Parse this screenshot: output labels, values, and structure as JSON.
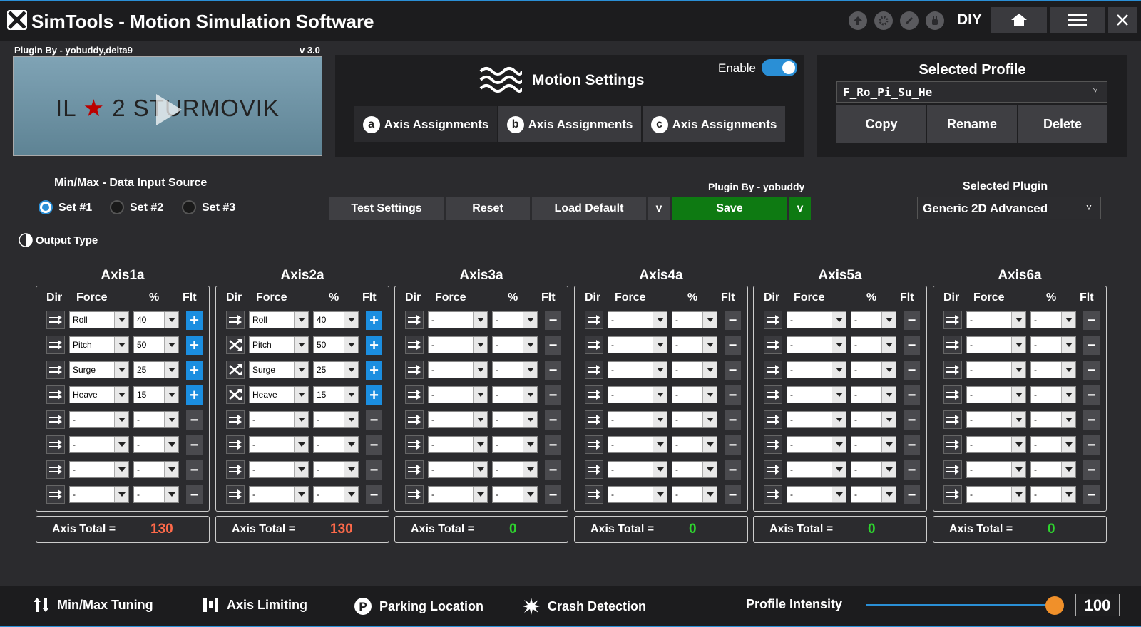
{
  "app": {
    "title": "SimTools - Motion Simulation Software",
    "mode": "DIY"
  },
  "plugin_info": {
    "by": "Plugin By - yobuddy,delta9",
    "version": "v 3.0"
  },
  "game_banner": {
    "title": "IL",
    "star": "★",
    "title_rest": "2 STURMOVIK"
  },
  "motion": {
    "title": "Motion Settings",
    "enable_label": "Enable",
    "enabled": true,
    "tabs": [
      {
        "letter": "a",
        "label": "Axis Assignments"
      },
      {
        "letter": "b",
        "label": "Axis Assignments"
      },
      {
        "letter": "c",
        "label": "Axis Assignments"
      }
    ]
  },
  "profile": {
    "title": "Selected Profile",
    "value": "F_Ro_Pi_Su_He",
    "copy": "Copy",
    "rename": "Rename",
    "delete": "Delete"
  },
  "data_input": {
    "title": "Min/Max - Data Input Source",
    "options": [
      "Set #1",
      "Set #2",
      "Set #3"
    ],
    "selected": "Set #1"
  },
  "actions": {
    "plugin_by": "Plugin By - yobuddy",
    "test": "Test Settings",
    "reset": "Reset",
    "load_default": "Load Default",
    "save": "Save",
    "chevron": "v"
  },
  "plugin": {
    "title": "Selected Plugin",
    "value": "Generic 2D Advanced",
    "chevron": "v"
  },
  "output_type": "Output Type",
  "axis_headers": {
    "dir": "Dir",
    "force": "Force",
    "pct": "%",
    "flt": "Flt"
  },
  "total_label": "Axis Total =",
  "axes": [
    {
      "name": "Axis1a",
      "total": "130",
      "total_color": "#ff6a4a",
      "rows": [
        [
          "Roll",
          "40",
          "plus",
          "normal"
        ],
        [
          "Pitch",
          "50",
          "plus",
          "normal"
        ],
        [
          "Surge",
          "25",
          "plus",
          "normal"
        ],
        [
          "Heave",
          "15",
          "plus",
          "normal"
        ],
        [
          "-",
          "-",
          "minus",
          "normal"
        ],
        [
          "-",
          "-",
          "minus",
          "normal"
        ],
        [
          "-",
          "-",
          "minus",
          "normal"
        ],
        [
          "-",
          "-",
          "minus",
          "normal"
        ]
      ]
    },
    {
      "name": "Axis2a",
      "total": "130",
      "total_color": "#ff6a4a",
      "rows": [
        [
          "Roll",
          "40",
          "plus",
          "normal"
        ],
        [
          "Pitch",
          "50",
          "plus",
          "reverse"
        ],
        [
          "Surge",
          "25",
          "plus",
          "reverse"
        ],
        [
          "Heave",
          "15",
          "plus",
          "reverse"
        ],
        [
          "-",
          "-",
          "minus",
          "normal"
        ],
        [
          "-",
          "-",
          "minus",
          "normal"
        ],
        [
          "-",
          "-",
          "minus",
          "normal"
        ],
        [
          "-",
          "-",
          "minus",
          "normal"
        ]
      ]
    },
    {
      "name": "Axis3a",
      "total": "0",
      "total_color": "#2ed42e",
      "rows": [
        [
          "-",
          "-",
          "minus",
          "normal"
        ],
        [
          "-",
          "-",
          "minus",
          "normal"
        ],
        [
          "-",
          "-",
          "minus",
          "normal"
        ],
        [
          "-",
          "-",
          "minus",
          "normal"
        ],
        [
          "-",
          "-",
          "minus",
          "normal"
        ],
        [
          "-",
          "-",
          "minus",
          "normal"
        ],
        [
          "-",
          "-",
          "minus",
          "normal"
        ],
        [
          "-",
          "-",
          "minus",
          "normal"
        ]
      ]
    },
    {
      "name": "Axis4a",
      "total": "0",
      "total_color": "#2ed42e",
      "rows": [
        [
          "-",
          "-",
          "minus",
          "normal"
        ],
        [
          "-",
          "-",
          "minus",
          "normal"
        ],
        [
          "-",
          "-",
          "minus",
          "normal"
        ],
        [
          "-",
          "-",
          "minus",
          "normal"
        ],
        [
          "-",
          "-",
          "minus",
          "normal"
        ],
        [
          "-",
          "-",
          "minus",
          "normal"
        ],
        [
          "-",
          "-",
          "minus",
          "normal"
        ],
        [
          "-",
          "-",
          "minus",
          "normal"
        ]
      ]
    },
    {
      "name": "Axis5a",
      "total": "0",
      "total_color": "#2ed42e",
      "rows": [
        [
          "-",
          "-",
          "minus",
          "normal"
        ],
        [
          "-",
          "-",
          "minus",
          "normal"
        ],
        [
          "-",
          "-",
          "minus",
          "normal"
        ],
        [
          "-",
          "-",
          "minus",
          "normal"
        ],
        [
          "-",
          "-",
          "minus",
          "normal"
        ],
        [
          "-",
          "-",
          "minus",
          "normal"
        ],
        [
          "-",
          "-",
          "minus",
          "normal"
        ],
        [
          "-",
          "-",
          "minus",
          "normal"
        ]
      ]
    },
    {
      "name": "Axis6a",
      "total": "0",
      "total_color": "#2ed42e",
      "rows": [
        [
          "-",
          "-",
          "minus",
          "normal"
        ],
        [
          "-",
          "-",
          "minus",
          "normal"
        ],
        [
          "-",
          "-",
          "minus",
          "normal"
        ],
        [
          "-",
          "-",
          "minus",
          "normal"
        ],
        [
          "-",
          "-",
          "minus",
          "normal"
        ],
        [
          "-",
          "-",
          "minus",
          "normal"
        ],
        [
          "-",
          "-",
          "minus",
          "normal"
        ],
        [
          "-",
          "-",
          "minus",
          "normal"
        ]
      ]
    }
  ],
  "bottom": {
    "minmax": "Min/Max Tuning",
    "limiting": "Axis Limiting",
    "parking": "Parking Location",
    "crash": "Crash Detection",
    "intensity_label": "Profile Intensity",
    "intensity": "100",
    "intensity_fraction": 1.0
  },
  "icons": {
    "top": [
      "upload-icon",
      "gear-icon",
      "pencil-icon",
      "hand-icon",
      "home-icon",
      "menu-icon",
      "close-icon"
    ],
    "bottom": [
      "updown-arrows-icon",
      "bars-icon",
      "parking-icon",
      "burst-icon"
    ]
  },
  "colors": {
    "accent": "#2a8fd6",
    "save": "#0e7a12",
    "over_total": "#ff6a4a",
    "ok_total": "#2ed42e",
    "slider_knob": "#f0902a"
  }
}
